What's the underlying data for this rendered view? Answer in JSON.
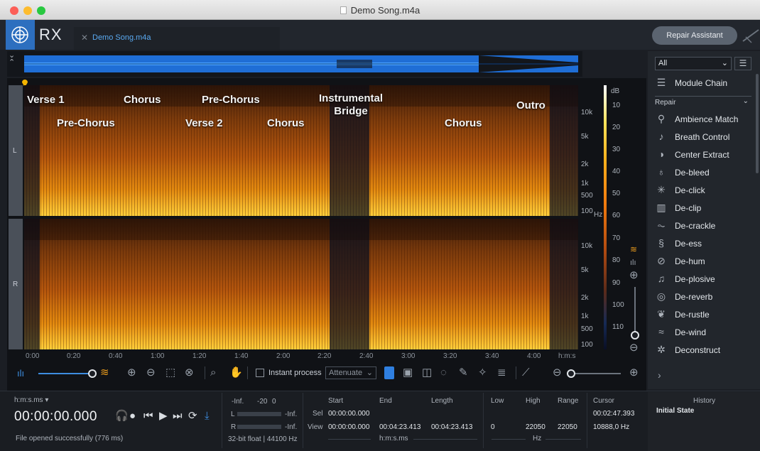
{
  "window": {
    "title": "Demo Song.m4a"
  },
  "app": {
    "name": "RX",
    "tab_label": "Demo Song.m4a",
    "repair_assistant_label": "Repair Assistant"
  },
  "channels": {
    "left": "L",
    "right": "R"
  },
  "sections": {
    "verse1": "Verse 1",
    "prechorus1": "Pre-Chorus",
    "chorus1": "Chorus",
    "prechorus2": "Pre-Chorus",
    "verse2": "Verse 2",
    "chorus2": "Chorus",
    "bridge_line1": "Instrumental",
    "bridge_line2": "Bridge",
    "chorus3": "Chorus",
    "outro": "Outro"
  },
  "freq_labels_L": [
    "10k",
    "5k",
    "2k",
    "1k",
    "500",
    "100"
  ],
  "freq_labels_R": [
    "10k",
    "5k",
    "2k",
    "1k",
    "500",
    "100"
  ],
  "freq_unit": "Hz",
  "db_unit": "dB",
  "db_labels": [
    "10",
    "20",
    "30",
    "40",
    "50",
    "60",
    "70",
    "80",
    "90",
    "100",
    "110"
  ],
  "time_ticks": [
    "0:00",
    "0:20",
    "0:40",
    "1:00",
    "1:20",
    "1:40",
    "2:00",
    "2:20",
    "2:40",
    "3:00",
    "3:20",
    "3:40",
    "4:00"
  ],
  "time_unit": "h:m:s",
  "toolbar": {
    "instant_process_label": "Instant process",
    "attenuate_value": "Attenuate"
  },
  "status": {
    "time_format": "h:m:s.ms",
    "timecode": "00:00:00.000",
    "message": "File opened successfully (776 ms)",
    "meter_header": [
      "-Inf.",
      "-20",
      "0"
    ],
    "meter_L_label": "L",
    "meter_L_value": "-Inf.",
    "meter_R_label": "R",
    "meter_R_value": "-Inf.",
    "format": "32-bit float | 44100 Hz",
    "col_start": "Start",
    "col_end": "End",
    "col_length": "Length",
    "row_sel": "Sel",
    "row_view": "View",
    "sel_start": "00:00:00.000",
    "view_start": "00:00:00.000",
    "view_end": "00:04:23.413",
    "view_length": "00:04:23.413",
    "time_unit_label": "h:m:s.ms",
    "col_low": "Low",
    "col_high": "High",
    "col_range": "Range",
    "low": "0",
    "high": "22050",
    "range": "22050",
    "hz_label": "Hz",
    "col_cursor": "Cursor",
    "cursor_time": "00:02:47.393",
    "cursor_freq": "10888,0 Hz"
  },
  "panel": {
    "filter": "All",
    "module_chain": "Module Chain",
    "category": "Repair",
    "modules": [
      "Ambience Match",
      "Breath Control",
      "Center Extract",
      "De-bleed",
      "De-click",
      "De-clip",
      "De-crackle",
      "De-ess",
      "De-hum",
      "De-plosive",
      "De-reverb",
      "De-rustle",
      "De-wind",
      "Deconstruct"
    ]
  },
  "history": {
    "title": "History",
    "item": "Initial State"
  }
}
